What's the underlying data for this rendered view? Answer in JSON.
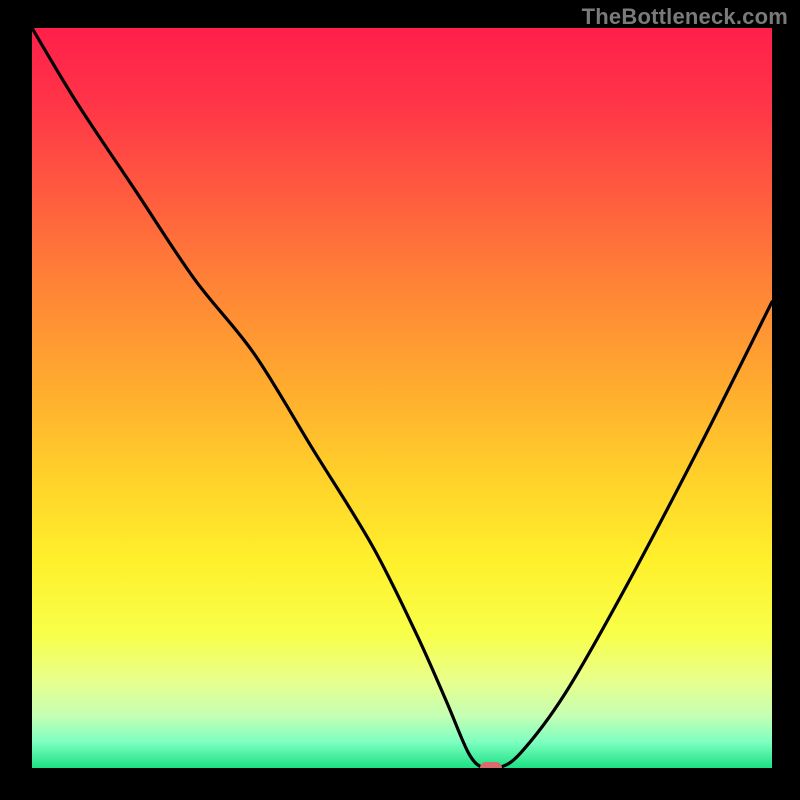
{
  "watermark": "TheBottleneck.com",
  "colors": {
    "black": "#000000",
    "curve": "#000000",
    "marker": "#d86b6e",
    "watermark": "#7a7a7a"
  },
  "gradient_stops": [
    {
      "offset": 0.0,
      "color": "#ff1f4a"
    },
    {
      "offset": 0.1,
      "color": "#ff3448"
    },
    {
      "offset": 0.22,
      "color": "#ff5a3f"
    },
    {
      "offset": 0.35,
      "color": "#ff8436"
    },
    {
      "offset": 0.48,
      "color": "#ffaa2f"
    },
    {
      "offset": 0.6,
      "color": "#ffcf2a"
    },
    {
      "offset": 0.72,
      "color": "#fff02c"
    },
    {
      "offset": 0.82,
      "color": "#f8ff4a"
    },
    {
      "offset": 0.88,
      "color": "#e9ff8a"
    },
    {
      "offset": 0.93,
      "color": "#c4ffb4"
    },
    {
      "offset": 0.965,
      "color": "#7dffc0"
    },
    {
      "offset": 1.0,
      "color": "#1de084"
    }
  ],
  "chart_data": {
    "type": "line",
    "title": "",
    "xlabel": "",
    "ylabel": "",
    "xlim": [
      0,
      100
    ],
    "ylim": [
      0,
      100
    ],
    "grid": false,
    "legend": false,
    "note": "Bottleneck V-curve: percent mismatch (y, 0=ideal at bottom, 100=worst at top) vs. relative component strength (x). Minimum marks balanced configuration. Values read off the shape; no axes shown.",
    "series": [
      {
        "name": "bottleneck-curve",
        "x": [
          0,
          6,
          14,
          22,
          30,
          38,
          46,
          52,
          56,
          59,
          61,
          63,
          66,
          72,
          80,
          90,
          100
        ],
        "y": [
          100,
          90,
          78,
          66,
          56,
          43,
          30,
          18,
          9,
          2,
          0,
          0,
          2,
          10,
          24,
          43,
          63
        ]
      }
    ],
    "marker": {
      "x": 62,
      "y": 0,
      "label": "optimal-point"
    }
  }
}
